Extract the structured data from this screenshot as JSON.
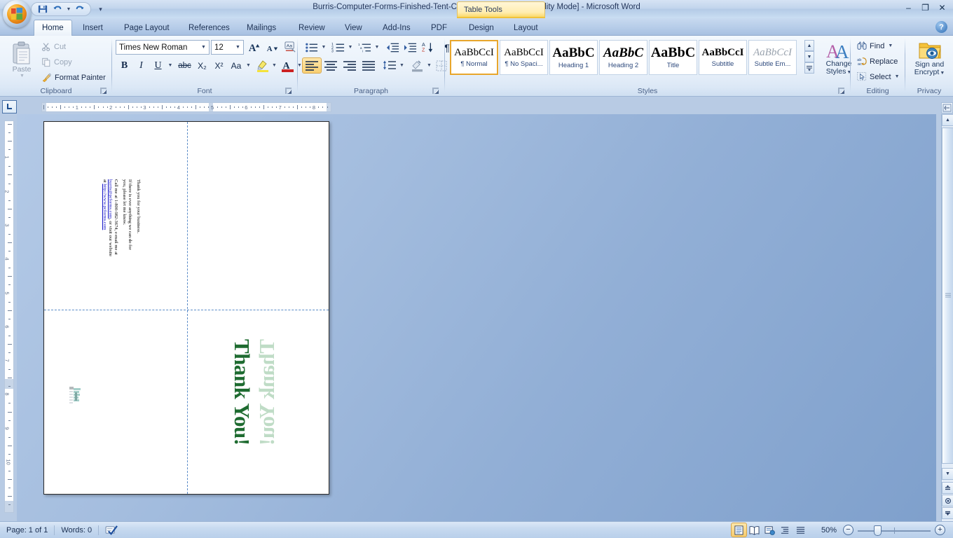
{
  "titlebar": {
    "document_title": "Burris-Computer-Forms-Finished-Tent-Card-Template [Compatibility Mode] - Microsoft Word",
    "office_button": "Office Button",
    "qat": [
      {
        "name": "save",
        "label": "Save",
        "icon": "save-icon"
      },
      {
        "name": "undo",
        "label": "Undo",
        "icon": "undo-icon"
      },
      {
        "name": "redo",
        "label": "Redo",
        "icon": "redo-icon"
      }
    ],
    "customize_qat": "Customize Quick Access Toolbar",
    "minimize": "–",
    "restore": "❐",
    "close": "✕"
  },
  "contextual": {
    "banner": "Table Tools",
    "tabs": [
      "Design",
      "Layout"
    ]
  },
  "tabs": [
    {
      "label": "Home",
      "active": true
    },
    {
      "label": "Insert",
      "active": false
    },
    {
      "label": "Page Layout",
      "active": false
    },
    {
      "label": "References",
      "active": false
    },
    {
      "label": "Mailings",
      "active": false
    },
    {
      "label": "Review",
      "active": false
    },
    {
      "label": "View",
      "active": false
    },
    {
      "label": "Add-Ins",
      "active": false
    },
    {
      "label": "PDF",
      "active": false
    }
  ],
  "help": "?",
  "ribbon": {
    "clipboard": {
      "label": "Clipboard",
      "paste": "Paste",
      "cut": "Cut",
      "copy": "Copy",
      "format_painter": "Format Painter",
      "launcher": "Clipboard dialog launcher"
    },
    "font": {
      "label": "Font",
      "font_name": "Times New Roman",
      "font_size": "12",
      "grow_font": "Grow Font",
      "shrink_font": "Shrink Font",
      "clear_formatting": "Clear Formatting",
      "bold": "B",
      "italic": "I",
      "underline": "U",
      "strikethrough": "abc",
      "subscript": "X₂",
      "superscript": "X²",
      "change_case": "Aa",
      "highlight": "Text Highlight Color",
      "font_color": "A",
      "launcher": "Font dialog launcher"
    },
    "paragraph": {
      "label": "Paragraph",
      "bullets": "Bullets",
      "numbering": "Numbering",
      "multilevel": "Multilevel List",
      "decrease_indent": "Decrease Indent",
      "increase_indent": "Increase Indent",
      "sort": "Sort",
      "show_marks": "¶",
      "align_left": "Align Left",
      "center": "Center",
      "align_right": "Align Right",
      "justify": "Justify",
      "line_spacing": "Line Spacing",
      "shading": "Shading",
      "borders": "Borders",
      "launcher": "Paragraph dialog launcher"
    },
    "styles": {
      "label": "Styles",
      "gallery": [
        {
          "preview": "AaBbCcI",
          "name": "¶ Normal",
          "selected": true,
          "style": "normal"
        },
        {
          "preview": "AaBbCcI",
          "name": "¶ No Spaci...",
          "selected": false,
          "style": "normal"
        },
        {
          "preview": "AaBbC",
          "name": "Heading 1",
          "selected": false,
          "style": "h1"
        },
        {
          "preview": "AaBbC",
          "name": "Heading 2",
          "selected": false,
          "style": "h2"
        },
        {
          "preview": "AaBbC",
          "name": "Title",
          "selected": false,
          "style": "title"
        },
        {
          "preview": "AaBbCcI",
          "name": "Subtitle",
          "selected": false,
          "style": "subtitle"
        },
        {
          "preview": "AaBbCcI",
          "name": "Subtle Em...",
          "selected": false,
          "style": "subtle"
        }
      ],
      "scroll_up": "▲",
      "scroll_down": "▼",
      "more": "☰",
      "change_styles": "Change\nStyles",
      "change_styles_line1": "Change",
      "change_styles_line2": "Styles",
      "launcher": "Styles dialog launcher"
    },
    "editing": {
      "label": "Editing",
      "find": "Find",
      "replace": "Replace",
      "select": "Select"
    },
    "privacy": {
      "label": "Privacy",
      "sign_and_encrypt_line1": "Sign and",
      "sign_and_encrypt_line2": "Encrypt"
    }
  },
  "ruler": {
    "tab_selector": "L",
    "horizontal_numbers": [
      "1",
      "2",
      "3",
      "4",
      "5",
      "6",
      "7",
      "8"
    ],
    "vertical_numbers": [
      "1",
      "2",
      "3",
      "4",
      "5",
      "6",
      "7",
      "8",
      "9",
      "10"
    ]
  },
  "document": {
    "card_text": {
      "line1": "Thank you for your business.",
      "line2": "If there is ever anything we can do for",
      "line3": "you, please let me know.",
      "line4_prefix": "Call me at 1-800-982-3674, e-mail me at",
      "email": "burris@pcforms.com",
      "line5_middle": ", or visit our website",
      "line6_prefix": "at ",
      "website": "http://www.pcforms.com"
    },
    "thank_you_art": "Thank You!",
    "thank_you_color": "#1e6b30",
    "thank_you_shadow_color": "#bfdcc6",
    "logo_alt": "burris-logo-watermark"
  },
  "statusbar": {
    "page": "Page: 1 of 1",
    "words": "Words: 0",
    "proofing": "Proofing errors check",
    "views": [
      {
        "name": "print-layout",
        "active": true
      },
      {
        "name": "full-screen-reading",
        "active": false
      },
      {
        "name": "web-layout",
        "active": false
      },
      {
        "name": "outline",
        "active": false
      },
      {
        "name": "draft",
        "active": false
      }
    ],
    "zoom_level": "50%",
    "zoom_out": "−",
    "zoom_in": "+"
  }
}
